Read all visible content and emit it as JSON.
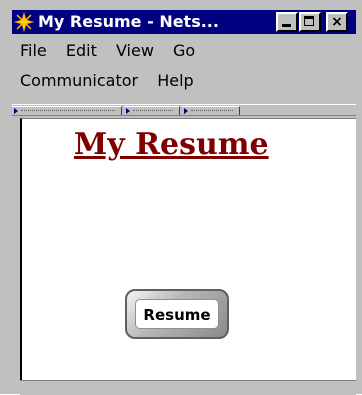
{
  "window": {
    "title": "My Resume - Nets...",
    "icon": "netscape-icon",
    "controls": [
      "minimize-icon",
      "maximize-icon",
      "close-icon"
    ],
    "close_glyph": "×"
  },
  "menubar": {
    "items": [
      {
        "label": "File"
      },
      {
        "label": "Edit"
      },
      {
        "label": "View"
      },
      {
        "label": "Go"
      },
      {
        "label": "Communicator"
      },
      {
        "label": "Help"
      }
    ]
  },
  "page": {
    "heading": "My Resume",
    "heading_color": "#800000",
    "button_label": "Resume"
  },
  "colors": {
    "titlebar": "#000080",
    "chrome": "#c0c0c0"
  }
}
